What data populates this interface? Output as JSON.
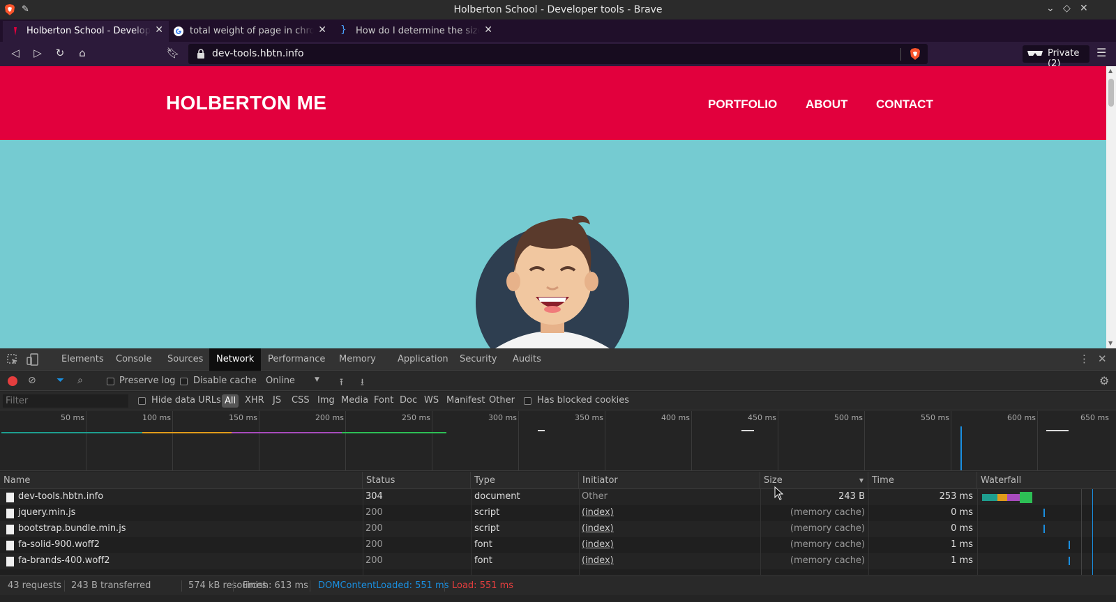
{
  "window": {
    "title": "Holberton School - Developer tools - Brave"
  },
  "tabs": [
    {
      "label": "Holberton School - Developer tools",
      "favicon": "holberton-favicon",
      "active": true
    },
    {
      "label": "total weight of page in chrome",
      "favicon": "google-favicon",
      "active": false
    },
    {
      "label": "How do I determine the size of",
      "favicon": "bracket-favicon",
      "active": false
    }
  ],
  "toolbar": {
    "url": "dev-tools.hbtn.info",
    "private_label": "Private (2)"
  },
  "site": {
    "brand": "HOLBERTON ME",
    "nav": [
      "PORTFOLIO",
      "ABOUT",
      "CONTACT"
    ],
    "colors": {
      "header": "#e2003d",
      "hero": "#75cbd1"
    }
  },
  "devtools": {
    "tabs": [
      "Elements",
      "Console",
      "Sources",
      "Network",
      "Performance",
      "Memory",
      "Application",
      "Security",
      "Audits"
    ],
    "active_tab": "Network",
    "network_toolbar": {
      "preserve_log": "Preserve log",
      "disable_cache": "Disable cache",
      "throttling": "Online"
    },
    "filter": {
      "placeholder": "Filter",
      "hide_data_urls": "Hide data URLs",
      "types": [
        "All",
        "XHR",
        "JS",
        "CSS",
        "Img",
        "Media",
        "Font",
        "Doc",
        "WS",
        "Manifest",
        "Other"
      ],
      "active_type": "All",
      "has_blocked_cookies": "Has blocked cookies"
    },
    "overview_ticks": [
      "50 ms",
      "100 ms",
      "150 ms",
      "200 ms",
      "250 ms",
      "300 ms",
      "350 ms",
      "400 ms",
      "450 ms",
      "500 ms",
      "550 ms",
      "600 ms",
      "650 ms"
    ],
    "columns": [
      "Name",
      "Status",
      "Type",
      "Initiator",
      "Size",
      "Time",
      "Waterfall"
    ],
    "sorted_column": "Size",
    "rows": [
      {
        "name": "dev-tools.hbtn.info",
        "status": "304",
        "type": "document",
        "initiator": "Other",
        "size": "243 B",
        "time": "253 ms"
      },
      {
        "name": "jquery.min.js",
        "status": "200",
        "type": "script",
        "initiator": "(index)",
        "size": "(memory cache)",
        "time": "0 ms"
      },
      {
        "name": "bootstrap.bundle.min.js",
        "status": "200",
        "type": "script",
        "initiator": "(index)",
        "size": "(memory cache)",
        "time": "0 ms"
      },
      {
        "name": "fa-solid-900.woff2",
        "status": "200",
        "type": "font",
        "initiator": "(index)",
        "size": "(memory cache)",
        "time": "1 ms"
      },
      {
        "name": "fa-brands-400.woff2",
        "status": "200",
        "type": "font",
        "initiator": "(index)",
        "size": "(memory cache)",
        "time": "1 ms"
      }
    ],
    "status_bar": {
      "requests": "43 requests",
      "transferred": "243 B transferred",
      "resources": "574 kB resources",
      "finish": "Finish: 613 ms",
      "dom_content_loaded": "DOMContentLoaded: 551 ms",
      "load": "Load: 551 ms"
    },
    "colors": {
      "dcl": "#1a8fe0",
      "load": "#e53e3e",
      "active_tab_bg": "#0e0e0e"
    }
  }
}
